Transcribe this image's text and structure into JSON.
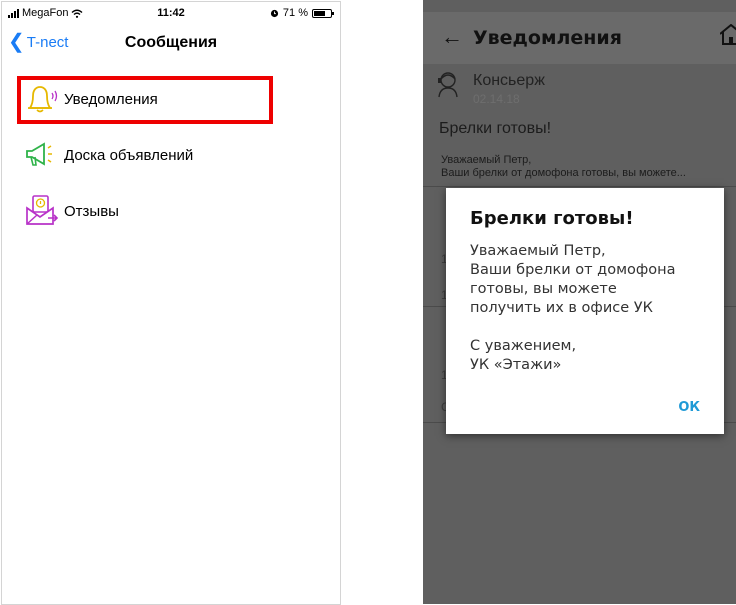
{
  "left_phone": {
    "status": {
      "carrier": "MegaFon",
      "time": "11:42",
      "battery_percent": "71 %",
      "battery_level": 0.71
    },
    "nav": {
      "back_label": "T-nect",
      "title": "Сообщения"
    },
    "items": [
      {
        "label": "Уведомления",
        "icon": "bell-icon"
      },
      {
        "label": "Доска объявлений",
        "icon": "megaphone-icon"
      },
      {
        "label": "Отзывы",
        "icon": "mail-feedback-icon"
      }
    ],
    "colors": {
      "accent": "#1a7cf5",
      "highlight": "#ee0000",
      "bell": "#e6b800",
      "megaphone": "#2fb34a",
      "feedback": "#b832c8"
    }
  },
  "right_phone": {
    "toolbar": {
      "title": "Уведомления",
      "back_icon": "arrow-back-icon",
      "home_icon": "home-icon"
    },
    "message": {
      "sender": "Консьерж",
      "date": "02.14.18",
      "title": "Брелки готовы!",
      "preview_line1": "Уважаемый Петр,",
      "preview_line2": "Ваши брелки от домофона готовы, вы можете..."
    },
    "dialog": {
      "title": "Брелки готовы!",
      "body_lines": [
        "Уважаемый Петр,",
        "Ваши брелки от домофона",
        "готовы, вы можете",
        "получить их в офисе УК"
      ],
      "sign_lines": [
        "С уважением,",
        "УК «Этажи»"
      ],
      "ok_label": "ОК"
    },
    "colors": {
      "overlay": "#5f5f5f",
      "dialog_accent": "#1f9ad6"
    }
  }
}
